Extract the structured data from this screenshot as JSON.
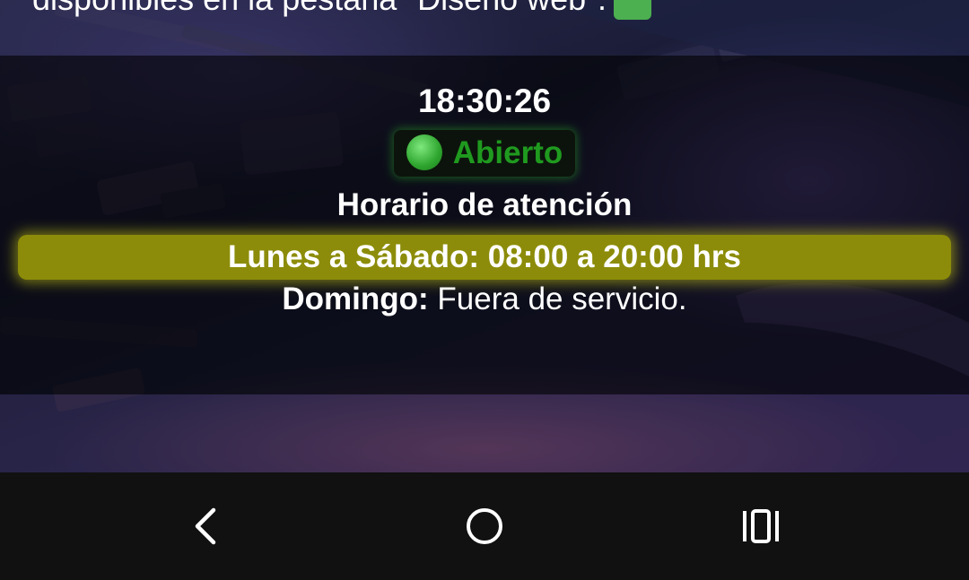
{
  "top_banner": {
    "text": "disponibles en la pestaña \"Diseño web\"."
  },
  "info_panel": {
    "clock": "18:30:26",
    "status": {
      "label": "Abierto",
      "color": "#1f9a1f"
    },
    "hours_title": "Horario de atención",
    "weekday_hours": "Lunes a Sábado: 08:00 a 20:00 hrs",
    "sunday": {
      "label": "Domingo:",
      "value": " Fuera de servicio."
    },
    "highlight_color": "#8c8c0a"
  },
  "navbar": {
    "back_icon": "back-chevron-icon",
    "home_icon": "home-circle-icon",
    "recents_icon": "recents-icon"
  }
}
